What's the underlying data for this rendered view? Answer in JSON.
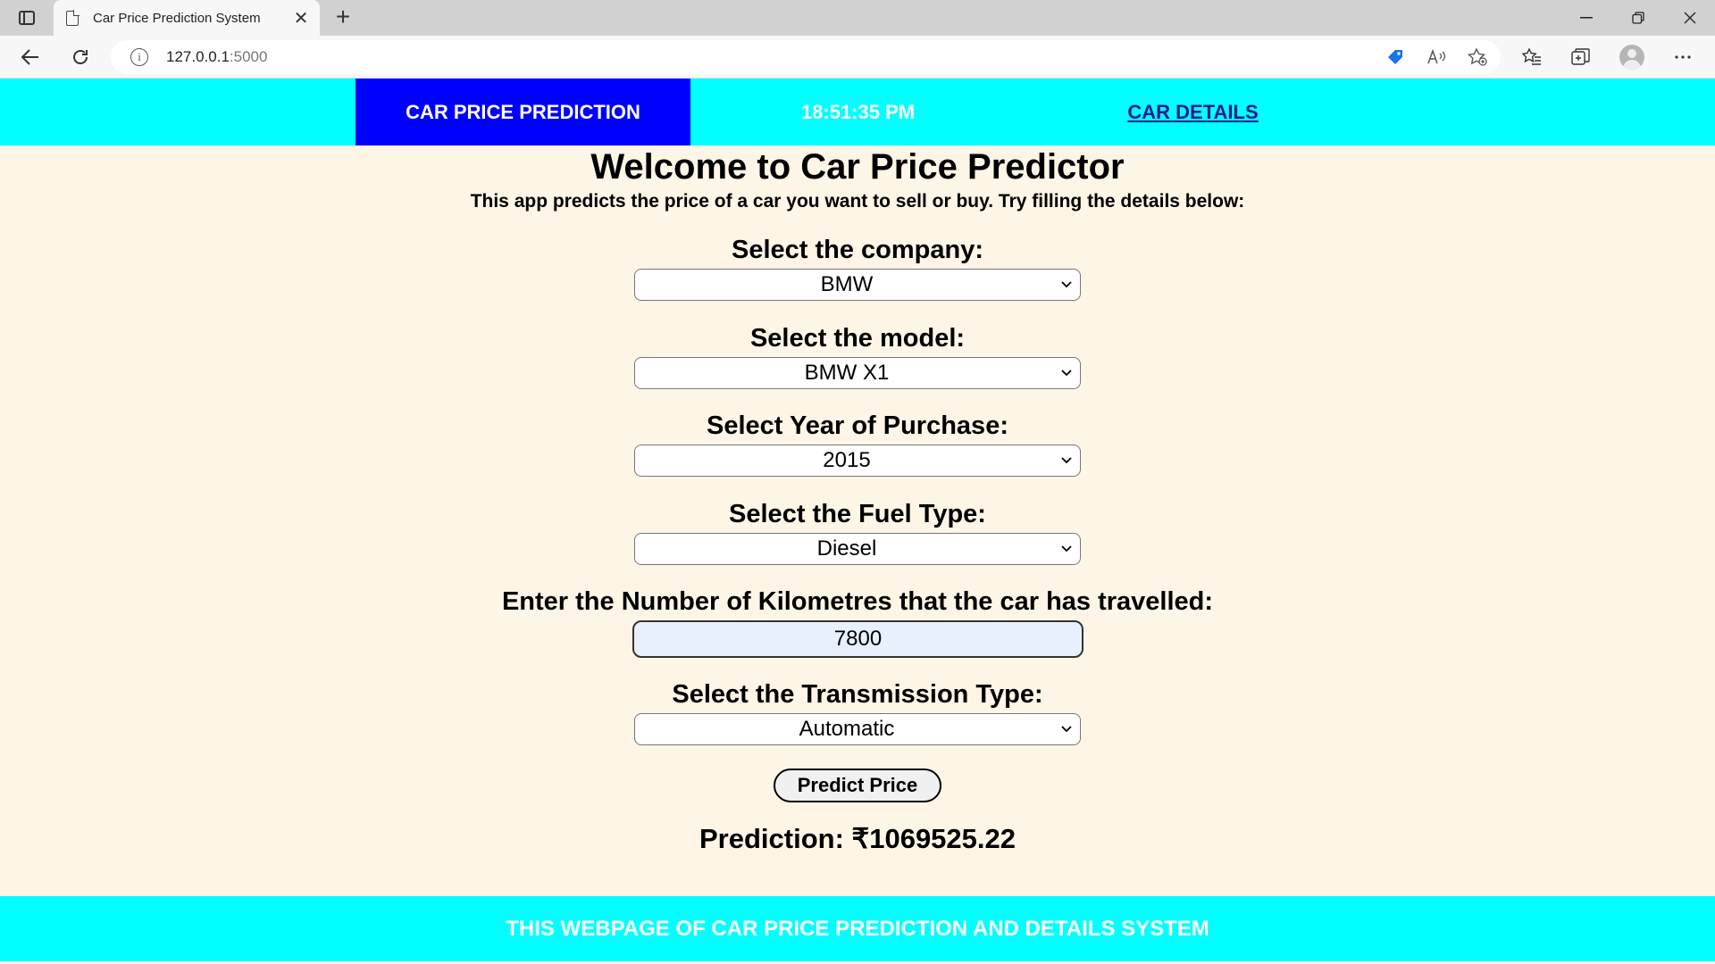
{
  "browser": {
    "tab_title": "Car Price Prediction System",
    "tab_close": "✕",
    "new_tab": "+",
    "url_host": "127.0.0.1",
    "url_port": ":5000"
  },
  "nav": {
    "brand": "CAR PRICE PREDICTION",
    "time": "18:51:35 PM",
    "link": "CAR DETAILS"
  },
  "header": {
    "title": "Welcome to Car Price Predictor",
    "subtitle": "This app predicts the price of a car you want to sell or buy. Try filling the details below:"
  },
  "form": {
    "company_label": "Select the company:",
    "company_value": "BMW",
    "model_label": "Select the model:",
    "model_value": "BMW X1",
    "year_label": "Select Year of Purchase:",
    "year_value": "2015",
    "fuel_label": "Select the Fuel Type:",
    "fuel_value": "Diesel",
    "km_label": "Enter the Number of Kilometres that the car has travelled:",
    "km_value": "7800",
    "transmission_label": "Select the Transmission Type:",
    "transmission_value": "Automatic",
    "predict_button": "Predict Price"
  },
  "result": {
    "prediction": "Prediction: ₹1069525.22"
  },
  "footer": {
    "text": "THIS WEBPAGE OF CAR PRICE PREDICTION AND DETAILS SYSTEM"
  },
  "colors": {
    "navbar": "#00ffff",
    "brand_bg": "#0000ff",
    "page_bg": "#fdf5e6",
    "nav_link": "#1a1a8f"
  }
}
